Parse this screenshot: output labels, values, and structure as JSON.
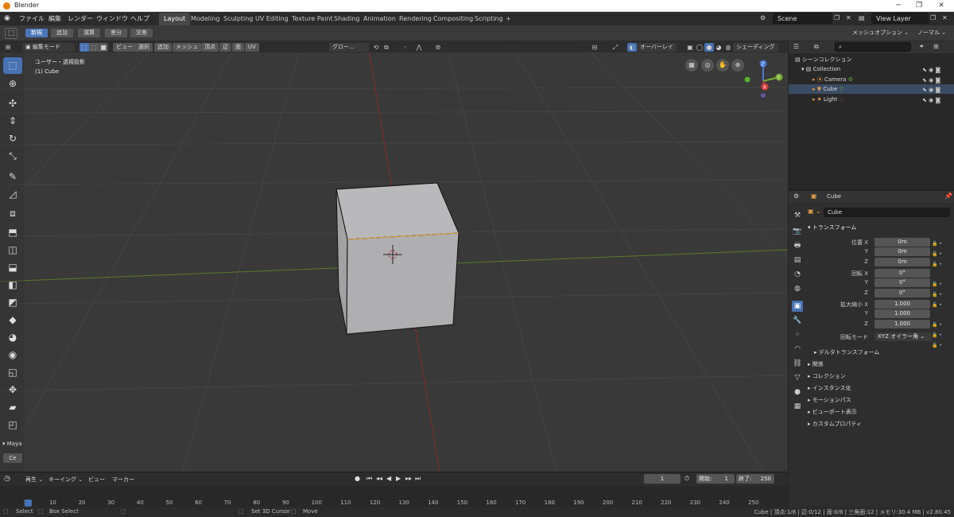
{
  "window": {
    "title": "Blender",
    "min": "─",
    "max": "❐",
    "close": "✕"
  },
  "menubar": {
    "items": [
      "ファイル",
      "編集",
      "レンダー",
      "ウィンドウ",
      "ヘルプ"
    ],
    "workspaces": [
      "Layout",
      "Modeling",
      "Sculpting",
      "UV Editing",
      "Texture Paint",
      "Shading",
      "Animation",
      "Rendering",
      "Compositing",
      "Scripting"
    ],
    "add_tab": "+",
    "scene": "Scene",
    "view_layer": "View Layer"
  },
  "toolsettings": {
    "modes": [
      "新規",
      "追加",
      "減算",
      "差分",
      "交差"
    ],
    "mesh_options": "メッシュオプション ⌄",
    "normal": "ノーマル ⌄"
  },
  "viewport_header": {
    "mode": "編集モード",
    "menus": [
      "ビュー",
      "選択",
      "追加",
      "メッシュ",
      "頂点",
      "辺",
      "面",
      "UV"
    ],
    "transform_orientation": "グロー...",
    "overlay": "オーバーレイ",
    "shading": "シェーディング"
  },
  "viewport": {
    "view_name": "ユーザー・透視投影",
    "object_name": "(1) Cube",
    "gizmo": {
      "x": "X",
      "y": "Y",
      "z": "Z"
    }
  },
  "left_tools": {
    "section": "Maya",
    "cmd": "Ce"
  },
  "outliner": {
    "title": "シーンコレクション",
    "collection": "Collection",
    "objects": [
      "Camera",
      "Cube",
      "Light"
    ]
  },
  "properties": {
    "object": "Cube",
    "object_field": "Cube",
    "transform_title": "トランスフォーム",
    "location_label": "位置 X",
    "rotation_label": "回転 X",
    "scale_label": "拡大縮小 X",
    "y_label": "Y",
    "z_label": "Z",
    "location": [
      "0m",
      "0m",
      "0m"
    ],
    "rotation": [
      "0°",
      "0°",
      "0°"
    ],
    "scale": [
      "1.000",
      "1.000",
      "1.000"
    ],
    "rotation_mode_label": "回転モード",
    "rotation_mode": "XYZ オイラー角",
    "delta": "デルタトランスフォーム",
    "panels": [
      "関係",
      "コレクション",
      "インスタンス化",
      "モーションパス",
      "ビューポート表示",
      "カスタムプロパティ"
    ]
  },
  "timeline": {
    "menus": [
      "再生 ⌄",
      "キーイング ⌄",
      "ビュー",
      "マーカー"
    ],
    "current_frame": "1",
    "start_label": "開始:",
    "start": "1",
    "end_label": "終了:",
    "end": "250",
    "ruler": [
      "1",
      "10",
      "20",
      "30",
      "40",
      "50",
      "60",
      "70",
      "80",
      "90",
      "100",
      "110",
      "120",
      "130",
      "140",
      "150",
      "160",
      "170",
      "180",
      "190",
      "200",
      "210",
      "220",
      "230",
      "240",
      "250"
    ]
  },
  "statusbar": {
    "select": "Select",
    "box_select": "Box Select",
    "cursor": "Set 3D Cursor",
    "move": "Move",
    "stats": "Cube | 頂点:1/8 | 辺:0/12 | 面:0/6 | 三角面:12 | メモリ:30.4 MB | v2.80.45"
  }
}
